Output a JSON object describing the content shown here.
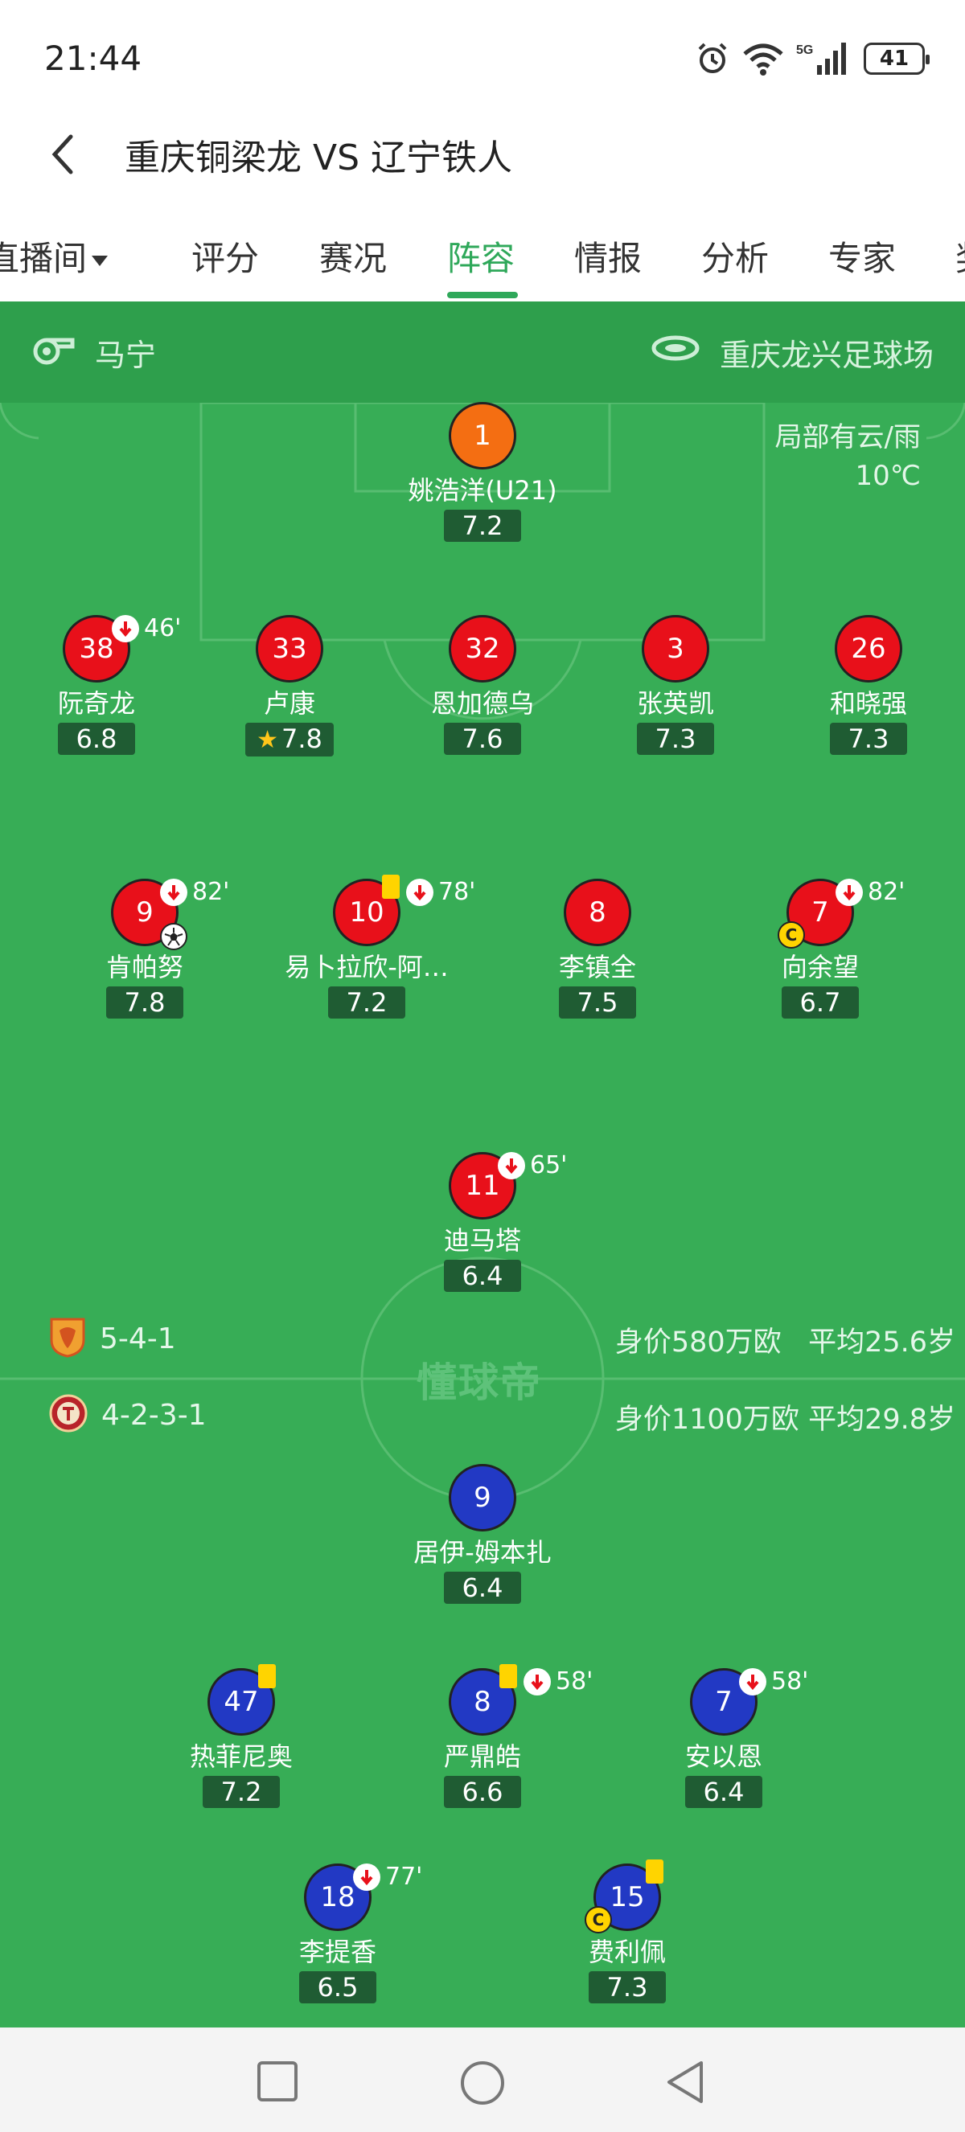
{
  "status": {
    "time": "21:44",
    "network": "5G",
    "battery": "41"
  },
  "header": {
    "title": "重庆铜梁龙 VS 辽宁铁人"
  },
  "tabs": [
    {
      "label": "直播间"
    },
    {
      "label": "评分"
    },
    {
      "label": "赛况"
    },
    {
      "label": "阵容"
    },
    {
      "label": "情报"
    },
    {
      "label": "分析"
    },
    {
      "label": "专家"
    },
    {
      "label": "奖"
    }
  ],
  "match_info": {
    "referee": "马宁",
    "stadium": "重庆龙兴足球场",
    "weather": "局部有云/雨",
    "temperature": "10℃"
  },
  "home": {
    "formation": "5-4-1",
    "value": "身价580万欧",
    "avg_age": "平均25.6岁",
    "players": [
      {
        "num": "1",
        "name": "姚浩洋(U21)",
        "rating": "7.2"
      },
      {
        "num": "38",
        "name": "阮奇龙",
        "rating": "6.8",
        "sub": "46'"
      },
      {
        "num": "33",
        "name": "卢康",
        "rating": "7.8"
      },
      {
        "num": "32",
        "name": "恩加德乌",
        "rating": "7.6"
      },
      {
        "num": "3",
        "name": "张英凯",
        "rating": "7.3"
      },
      {
        "num": "26",
        "name": "和晓强",
        "rating": "7.3"
      },
      {
        "num": "9",
        "name": "肯帕努",
        "rating": "7.8",
        "sub": "82'"
      },
      {
        "num": "10",
        "name": "易卜拉欣-阿…",
        "rating": "7.2",
        "sub": "78'"
      },
      {
        "num": "8",
        "name": "李镇全",
        "rating": "7.5"
      },
      {
        "num": "7",
        "name": "向余望",
        "rating": "6.7",
        "sub": "82'",
        "captain": "C"
      },
      {
        "num": "11",
        "name": "迪马塔",
        "rating": "6.4",
        "sub": "65'"
      }
    ]
  },
  "away": {
    "formation": "4-2-3-1",
    "value": "身价1100万欧",
    "avg_age": "平均29.8岁",
    "players": [
      {
        "num": "9",
        "name": "居伊-姆本扎",
        "rating": "6.4"
      },
      {
        "num": "47",
        "name": "热菲尼奥",
        "rating": "7.2"
      },
      {
        "num": "8",
        "name": "严鼎皓",
        "rating": "6.6",
        "sub": "58'"
      },
      {
        "num": "7",
        "name": "安以恩",
        "rating": "6.4",
        "sub": "58'"
      },
      {
        "num": "18",
        "name": "李提香",
        "rating": "6.5",
        "sub": "77'"
      },
      {
        "num": "15",
        "name": "费利佩",
        "rating": "7.3",
        "captain": "C"
      }
    ]
  },
  "watermark": "懂球帝",
  "colors": {
    "pitch": "#37ad56",
    "accent": "#2fa85a",
    "home": "#e8101a",
    "away": "#2239c4",
    "keeper": "#f46e12",
    "rating_bg": "#1f5c33"
  },
  "icons": {
    "referee": "whistle-icon",
    "stadium": "stadium-icon",
    "back": "chevron-left-icon",
    "sub_off": "arrow-down-icon",
    "goal": "soccer-ball-icon"
  }
}
